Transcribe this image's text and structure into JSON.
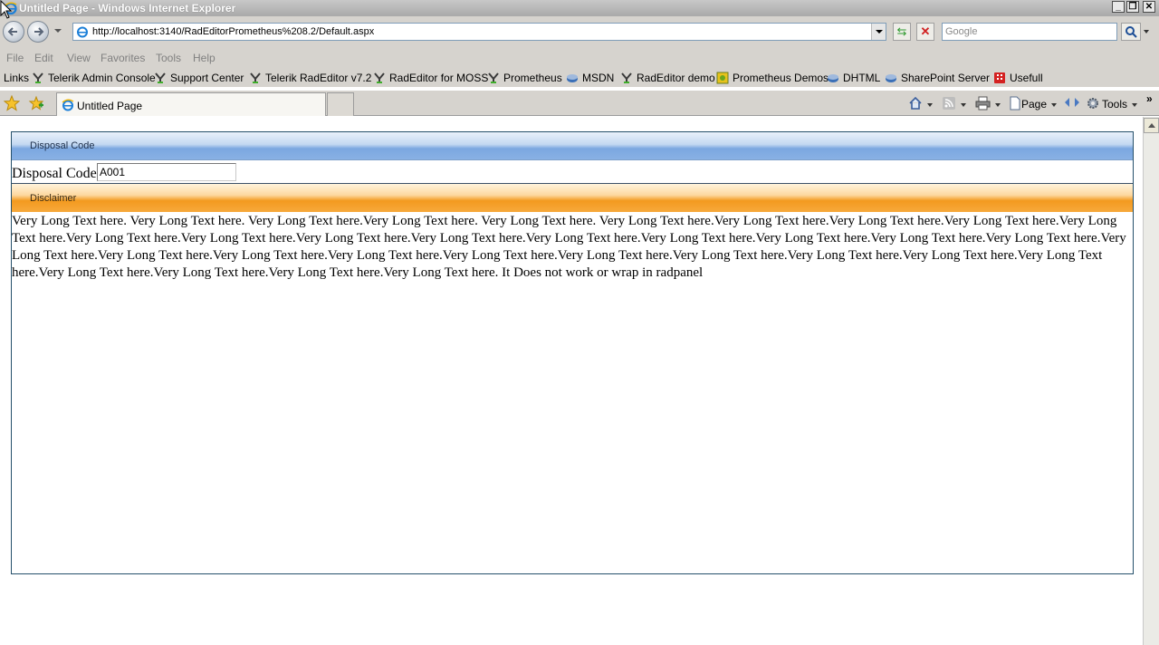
{
  "window": {
    "title": "Untitled Page - Windows Internet Explorer",
    "controls": [
      "_",
      "❐",
      "✕"
    ]
  },
  "address": {
    "url": "http://localhost:3140/RadEditorPrometheus%208.2/Default.aspx",
    "search_placeholder": "Google"
  },
  "menu": [
    "File",
    "Edit",
    "View",
    "Favorites",
    "Tools",
    "Help"
  ],
  "links": {
    "label": "Links",
    "items": [
      {
        "label": "Telerik Admin Console",
        "icon": "telerik-icon"
      },
      {
        "label": "Support Center",
        "icon": "telerik-icon"
      },
      {
        "label": "Telerik RadEditor v7.2",
        "icon": "telerik-icon"
      },
      {
        "label": "RadEditor for MOSS",
        "icon": "telerik-icon"
      },
      {
        "label": "Prometheus",
        "icon": "telerik-icon"
      },
      {
        "label": "MSDN",
        "icon": "msdn-icon"
      },
      {
        "label": "RadEditor demo",
        "icon": "telerik-icon"
      },
      {
        "label": "Prometheus Demos",
        "icon": "demos-icon"
      },
      {
        "label": "DHTML",
        "icon": "msdn-icon"
      },
      {
        "label": "SharePoint Server",
        "icon": "msdn-icon"
      },
      {
        "label": "Usefull",
        "icon": "red-page-icon"
      }
    ]
  },
  "tabs": [
    {
      "label": "Untitled Page",
      "active": true
    }
  ],
  "commandbar": {
    "page": "Page",
    "tools": "Tools"
  },
  "page": {
    "panels": [
      {
        "header": "Disposal Code",
        "color": "#7ba7e0"
      },
      {
        "header": "Disclaimer",
        "color": "#f39a1f"
      }
    ],
    "disposal_label": "Disposal Code",
    "disposal_value": "A001",
    "disclaimer_text": "Very Long Text here. Very Long Text here. Very Long Text here.Very Long Text here. Very Long Text here. Very Long Text here.Very Long Text here.Very Long Text here.Very Long Text here.Very Long Text here.Very Long Text here.Very Long Text here.Very Long Text here.Very Long Text here.Very Long Text here.Very Long Text here.Very Long Text here.Very Long Text here.Very Long Text here.Very Long Text here.Very Long Text here.Very Long Text here.Very Long Text here.Very Long Text here.Very Long Text here.Very Long Text here.Very Long Text here.Very Long Text here.Very Long Text here.Very Long Text here.Very Long Text here.Very Long Text here.Very Long Text here. It Does not work or wrap in radpanel"
  }
}
